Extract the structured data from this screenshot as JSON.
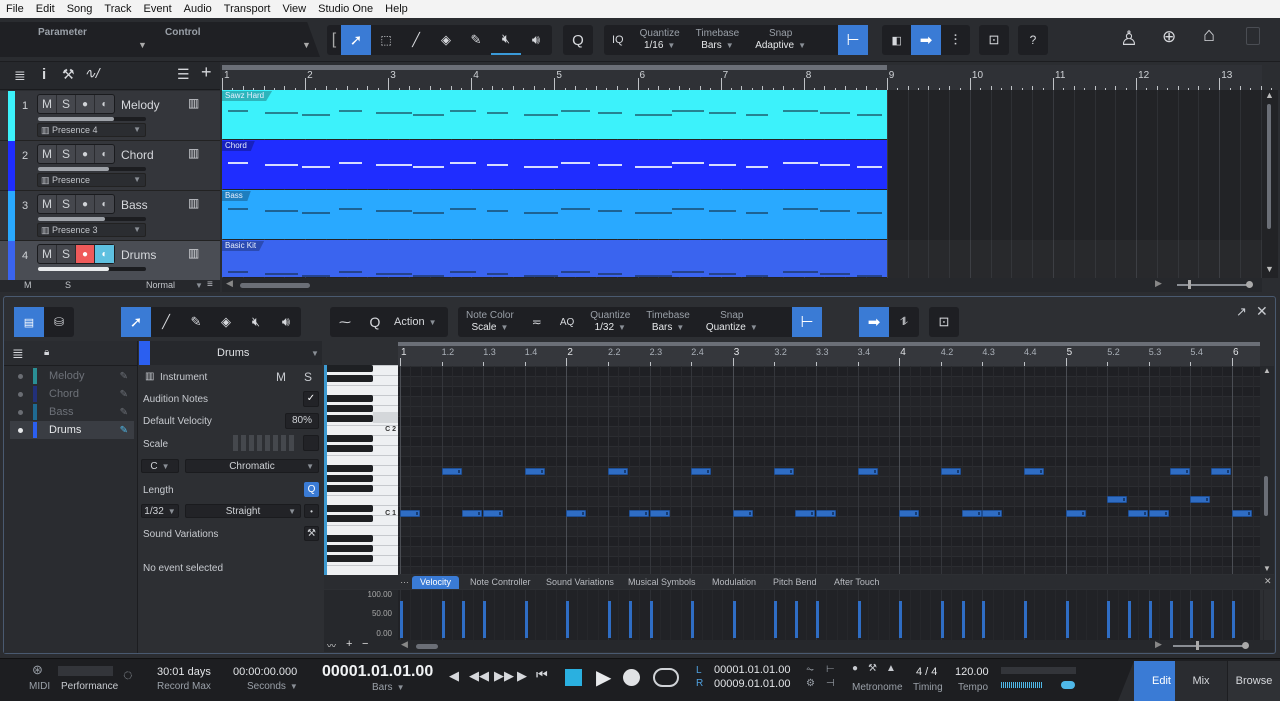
{
  "menu": [
    "File",
    "Edit",
    "Song",
    "Track",
    "Event",
    "Audio",
    "Transport",
    "View",
    "Studio One",
    "Help"
  ],
  "toolbar": {
    "parameter_label": "Parameter",
    "control_label": "Control",
    "tools": [
      "arrow-tool",
      "range-tool",
      "split-tool",
      "eraser-tool",
      "paint-tool",
      "mute-tool",
      "listen-tool"
    ],
    "q_label": "Q",
    "iq_label": "IQ",
    "quantize": {
      "label": "Quantize",
      "value": "1/16"
    },
    "timebase": {
      "label": "Timebase",
      "value": "Bars"
    },
    "snap": {
      "label": "Snap",
      "value": "Adaptive"
    },
    "help_label": "?"
  },
  "arrange": {
    "tracks": [
      {
        "num": "1",
        "name": "Melody",
        "instrument": "Presence 4",
        "color": "#3cf2fb",
        "fader": 0.7,
        "clip": "Sawz Hard",
        "clip_color": "#3cf2fb"
      },
      {
        "num": "2",
        "name": "Chord",
        "instrument": "Presence",
        "color": "#1f2dff",
        "fader": 0.66,
        "clip": "Chord",
        "clip_color": "#1f2dff"
      },
      {
        "num": "3",
        "name": "Bass",
        "instrument": "Presence 3",
        "color": "#29a9ff",
        "fader": 0.62,
        "clip": "Bass",
        "clip_color": "#29a9ff"
      },
      {
        "num": "4",
        "name": "Drums",
        "instrument": "",
        "color": "#3a64ef",
        "fader": 0.66,
        "clip": "Basic Kit",
        "clip_color": "#3a64ef"
      }
    ],
    "btn_m": "M",
    "btn_s": "S",
    "footer": {
      "m": "M",
      "s": "S",
      "mode": "Normal"
    },
    "ruler_bars": [
      "1",
      "2",
      "3",
      "4",
      "5",
      "6",
      "7",
      "8",
      "9",
      "10",
      "11",
      "12",
      "13"
    ]
  },
  "editor": {
    "tools_label_action": "Action",
    "note_color": {
      "label": "Note Color",
      "value": "Scale"
    },
    "aq_label": "AQ",
    "quantize": {
      "label": "Quantize",
      "value": "1/32"
    },
    "timebase": {
      "label": "Timebase",
      "value": "Bars"
    },
    "snap": {
      "label": "Snap",
      "value": "Quantize"
    },
    "track_list": [
      {
        "name": "Melody",
        "color": "#2a8f95",
        "selected": false
      },
      {
        "name": "Chord",
        "color": "#22307a",
        "selected": false
      },
      {
        "name": "Bass",
        "color": "#1f6a92",
        "selected": false
      },
      {
        "name": "Drums",
        "color": "#2b5ff0",
        "selected": true
      }
    ],
    "inspector": {
      "track_name": "Drums",
      "instrument_label": "Instrument",
      "m": "M",
      "s": "S",
      "audition_notes": "Audition Notes",
      "audition_checked": true,
      "default_velocity_label": "Default Velocity",
      "default_velocity": "80%",
      "scale_label": "Scale",
      "scale_root": "C",
      "scale_type": "Chromatic",
      "length_label": "Length",
      "length_value": "1/32",
      "length_mode": "Straight",
      "sound_variations": "Sound Variations",
      "status": "No event selected"
    },
    "piano_labels": [
      "C 2",
      "C 1"
    ],
    "ruler": [
      "1",
      "1.2",
      "1.3",
      "1.4",
      "2",
      "2.2",
      "2.3",
      "2.4",
      "3",
      "3.2",
      "3.3",
      "3.4",
      "4",
      "4.2",
      "4.3",
      "4.4",
      "5",
      "5.2",
      "5.3",
      "5.4",
      "6"
    ],
    "notes": {
      "row_upper": [
        1.25,
        1.75,
        2.25,
        2.75,
        3.25,
        3.75,
        4.25,
        4.75,
        5.625,
        5.875
      ],
      "row_mid": [
        5.25,
        5.75
      ],
      "row_lower": [
        1.0,
        1.375,
        1.5,
        2.0,
        2.375,
        2.5,
        3.0,
        3.375,
        3.5,
        4.0,
        4.375,
        4.5,
        5.0,
        5.375,
        5.5,
        6.0
      ]
    },
    "controller_tabs": [
      "Velocity",
      "Note Controller",
      "Sound Variations",
      "Musical Symbols",
      "Modulation",
      "Pitch Bend",
      "After Touch"
    ],
    "active_controller_tab": "Velocity",
    "velocity_scale": [
      "100.00",
      "50.00",
      "0.00"
    ],
    "velocity_percent": 80
  },
  "transport": {
    "midi": "MIDI",
    "performance": "Performance",
    "record_max_value": "30:01 days",
    "record_max_label": "Record Max",
    "seconds_value": "00:00:00.000",
    "seconds_label": "Seconds",
    "bars_value": "00001.01.01.00",
    "bars_label": "Bars",
    "loop_l_label": "L",
    "loop_r_label": "R",
    "loop_l": "00001.01.01.00",
    "loop_r": "00009.01.01.00",
    "metronome": "Metronome",
    "timing_value": "4 / 4",
    "timing_label": "Timing",
    "tempo_value": "120.00",
    "tempo_label": "Tempo",
    "modes": [
      "Edit",
      "Mix",
      "Browse"
    ],
    "active_mode": "Edit"
  }
}
